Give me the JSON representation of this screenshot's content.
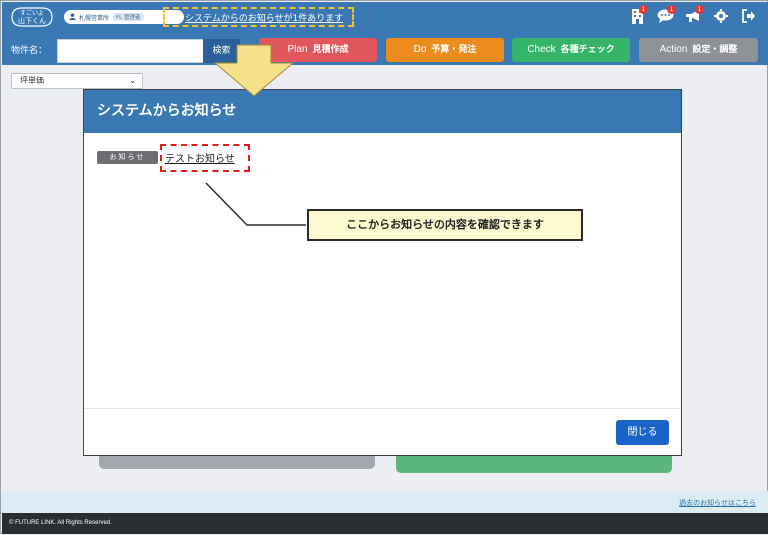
{
  "header": {
    "logo_line1": "すごいよ",
    "logo_line2": "山下くん",
    "user_office": "札幌営業所",
    "user_role": "FL 管理者",
    "notice_text": "システムからのお知らせが1件あります",
    "badges": [
      "1",
      "1",
      "1"
    ],
    "icons": [
      "building-icon",
      "chat-icon",
      "megaphone-icon",
      "gear-icon",
      "logout-icon"
    ]
  },
  "actionbar": {
    "property_label": "物件名：",
    "property_value": "",
    "search_label": "検索",
    "plan_en": "Plan",
    "plan_jp": "見積作成",
    "do_en": "Do",
    "do_jp": "予算・発注",
    "check_en": "Check",
    "check_jp": "各種チェック",
    "action_en": "Action",
    "action_jp": "設定・調整"
  },
  "unit_select": {
    "selected": "坪単価"
  },
  "modal": {
    "title": "システムからお知らせ",
    "tag": "お知らせ",
    "notice_link": "テストお知らせ",
    "close_label": "閉じる"
  },
  "callout": {
    "text": "ここからお知らせの内容を確認できます"
  },
  "news_strip": {
    "past_link": "過去のお知らせはこちら"
  },
  "footer": {
    "copyright": "© FUTURE LINK. All Rights Reserved."
  },
  "colors": {
    "primary": "#3a78b4",
    "plan": "#e2575e",
    "do": "#ec8c1c",
    "check": "#36b56a",
    "action": "#8e9195",
    "highlight_yellow": "#f1c232",
    "highlight_red": "#e31c1c",
    "close_button": "#1a63c7"
  }
}
